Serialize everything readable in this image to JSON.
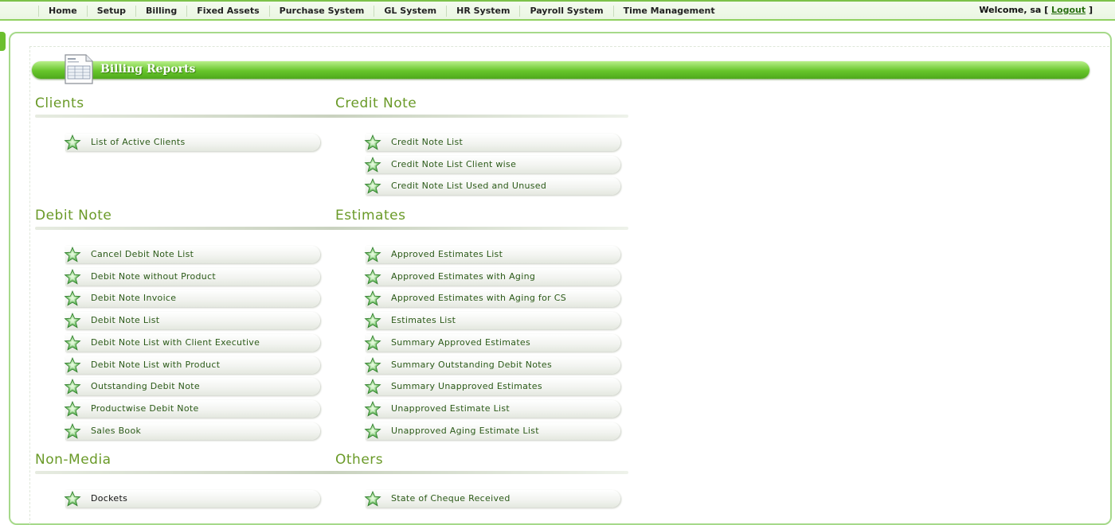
{
  "nav": {
    "items": [
      "Home",
      "Setup",
      "Billing",
      "Fixed Assets",
      "Purchase System",
      "GL System",
      "HR System",
      "Payroll System",
      "Time Management"
    ],
    "welcome_prefix": "Welcome, ",
    "user": "sa",
    "open_bracket": " [ ",
    "logout": "Logout",
    "close_bracket": " ]"
  },
  "page": {
    "title": "Billing Reports"
  },
  "sections": {
    "clients": {
      "title": "Clients",
      "items": [
        "List of Active Clients"
      ]
    },
    "credit_note": {
      "title": "Credit Note",
      "items": [
        "Credit Note List",
        "Credit Note List Client wise",
        "Credit Note List Used and Unused"
      ]
    },
    "debit_note": {
      "title": "Debit Note",
      "items": [
        "Cancel Debit Note List",
        "Debit Note without Product",
        "Debit Note Invoice",
        "Debit Note List",
        "Debit Note List with Client Executive",
        "Debit Note List with Product",
        "Outstanding Debit Note",
        "Productwise Debit Note",
        "Sales Book"
      ]
    },
    "estimates": {
      "title": "Estimates",
      "items": [
        "Approved Estimates List",
        "Approved Estimates with Aging",
        "Approved Estimates with Aging for CS",
        "Estimates List",
        "Summary Approved Estimates",
        "Summary Outstanding Debit Notes",
        "Summary Unapproved Estimates",
        "Unapproved Estimate List",
        "Unapproved Aging Estimate List"
      ]
    },
    "non_media": {
      "title": "Non-Media",
      "items": [
        "Dockets"
      ]
    },
    "others": {
      "title": "Others",
      "items": [
        "State of Cheque Received"
      ]
    }
  },
  "colors": {
    "accent": "#6cbf2e",
    "section_title": "#6a9a28",
    "link_text": "#2b5a18"
  }
}
